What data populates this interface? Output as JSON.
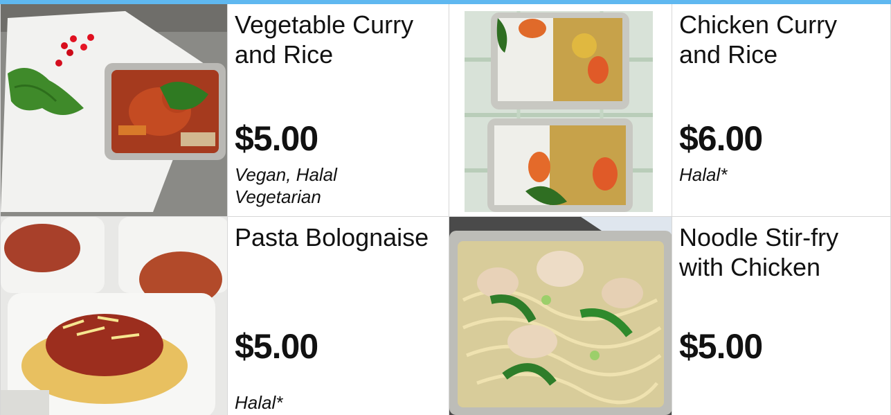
{
  "menu": {
    "items": [
      {
        "name": "Vegetable Curry and Rice",
        "name_line1": "Vegetable Curry",
        "name_line2": "and Rice",
        "price": "$5.00",
        "tags_line1": "Vegan, Halal",
        "tags_line2": "Vegetarian",
        "photo": "vegetable-curry-photo"
      },
      {
        "name": "Chicken Curry and Rice",
        "name_line1": "Chicken Curry",
        "name_line2": "and Rice",
        "price": "$6.00",
        "tags_line1": "Halal*",
        "tags_line2": "",
        "photo": "chicken-curry-photo"
      },
      {
        "name": "Pasta Bolognaise",
        "name_line1": "Pasta Bolognaise",
        "name_line2": "",
        "price": "$5.00",
        "tags_line1": "Halal*",
        "tags_line2": "",
        "photo": "pasta-bolognaise-photo"
      },
      {
        "name": "Noodle Stir-fry with Chicken",
        "name_line1": "Noodle Stir-fry",
        "name_line2": "with Chicken",
        "price": "$5.00",
        "tags_line1": "",
        "tags_line2": "",
        "photo": "noodle-stirfry-photo"
      }
    ]
  },
  "colors": {
    "accent_bar": "#5fb8f0",
    "cell_border": "#d6d6d6",
    "text": "#111111"
  }
}
